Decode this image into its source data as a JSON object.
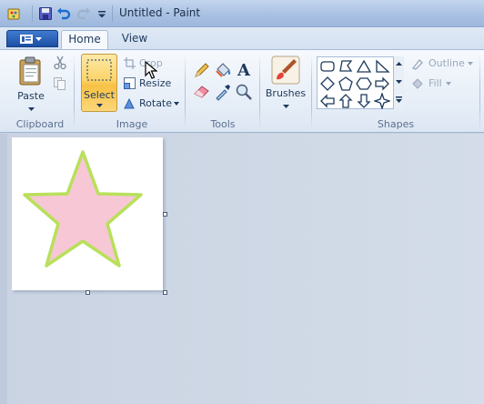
{
  "window": {
    "title": "Untitled - Paint"
  },
  "tabs": [
    {
      "label": "Home",
      "active": true
    },
    {
      "label": "View",
      "active": false
    }
  ],
  "ribbon": {
    "clipboard": {
      "group_label": "Clipboard",
      "paste_label": "Paste"
    },
    "image": {
      "group_label": "Image",
      "select_label": "Select",
      "crop_label": "Crop",
      "resize_label": "Resize",
      "rotate_label": "Rotate"
    },
    "tools": {
      "group_label": "Tools"
    },
    "brushes": {
      "label": "Brushes"
    },
    "shapes": {
      "group_label": "Shapes",
      "outline_label": "Outline",
      "fill_label": "Fill"
    }
  },
  "canvas": {
    "drawing": "star",
    "star_fill": "#f7c7d6",
    "star_outline": "#b8e05a"
  },
  "colors": {
    "accent": "#1c4fa3",
    "select_highlight": "#fbd46a",
    "workspace": "#cfd9e6"
  }
}
